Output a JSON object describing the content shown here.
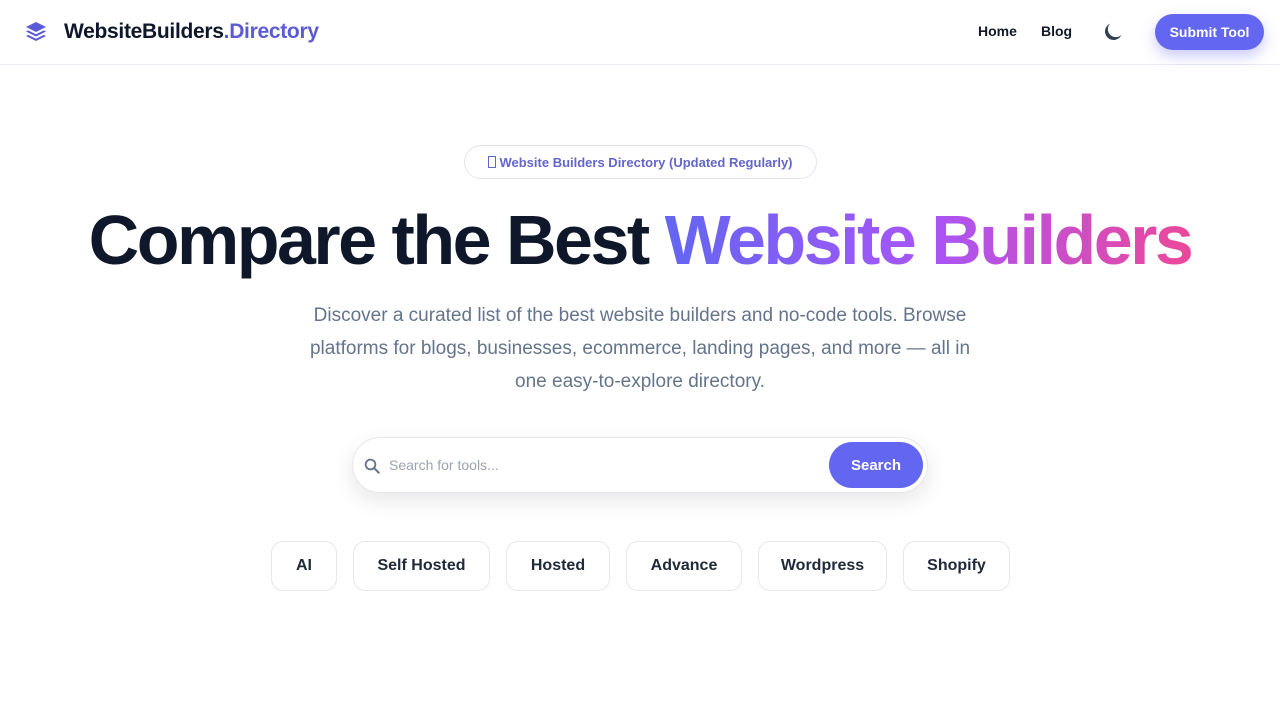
{
  "header": {
    "brand_main": "WebsiteBuilders",
    "brand_accent": ".Directory",
    "nav": {
      "home": "Home",
      "blog": "Blog"
    },
    "submit_label": "Submit Tool",
    "icons": {
      "logo": "stack-layers-icon",
      "theme": "moon-icon"
    }
  },
  "hero": {
    "badge": "Website Builders Directory (Updated Regularly)",
    "title_plain": "Compare the Best",
    "title_gradient": "Website Builders",
    "description": "Discover a curated list of the best website builders and no-code tools. Browse platforms for blogs, businesses, ecommerce, landing pages, and more — all in one easy-to-explore directory."
  },
  "search": {
    "value": "",
    "placeholder": "Search for tools...",
    "button_label": "Search"
  },
  "categories": [
    "AI",
    "Self Hosted",
    "Hosted",
    "Advance",
    "Wordpress",
    "Shopify"
  ],
  "colors": {
    "accent": "#6366f1",
    "brand_accent": "#5b5bd6",
    "gradient_start": "#6366f1",
    "gradient_mid": "#a855f7",
    "gradient_end": "#ec4899",
    "heading": "#0f172a",
    "muted_text": "#64748b"
  }
}
